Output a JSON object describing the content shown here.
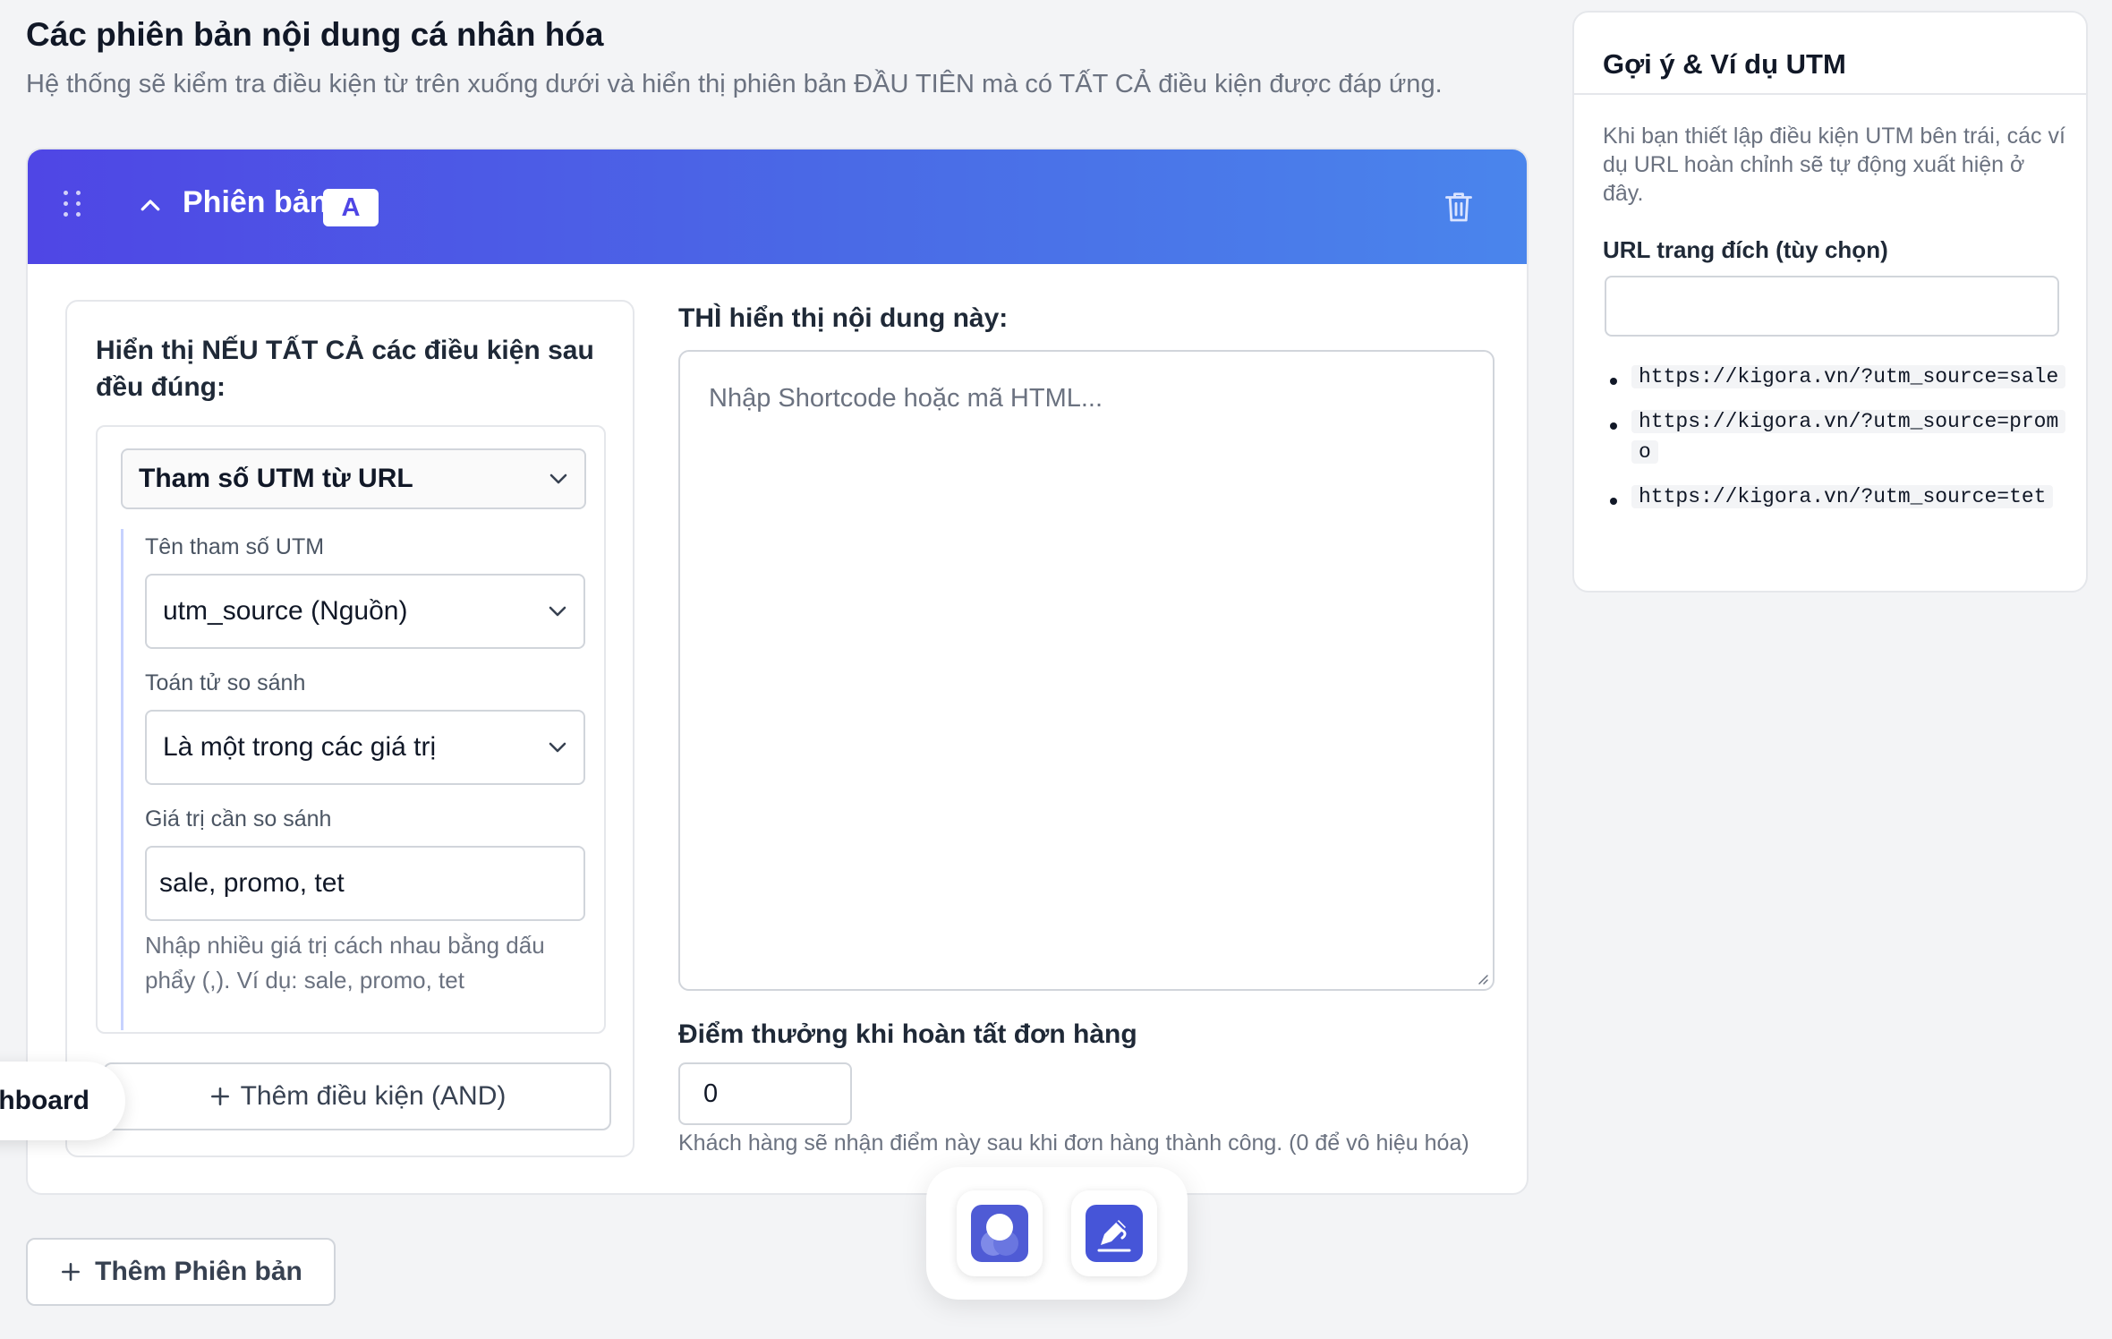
{
  "page": {
    "title": "Các phiên bản nội dung cá nhân hóa",
    "subtitle": "Hệ thống sẽ kiểm tra điều kiện từ trên xuống dưới và hiển thị phiên bản ĐẦU TIÊN mà có TẤT CẢ điều kiện được đáp ứng."
  },
  "version": {
    "label": "Phiên bản",
    "badge": "A",
    "icons": {
      "drag": "drag-handle-icon",
      "collapse": "chevron-up-icon",
      "delete": "trash-icon"
    },
    "conditions": {
      "heading": "Hiển thị NẾU TẤT CẢ các điều kiện sau đều đúng:",
      "type_select": "Tham số UTM từ URL",
      "param_label": "Tên tham số UTM",
      "param_value": "utm_source (Nguồn)",
      "operator_label": "Toán tử so sánh",
      "operator_value": "Là một trong các giá trị",
      "compare_label": "Giá trị cần so sánh",
      "compare_value": "sale, promo, tet",
      "compare_help": "Nhập nhiều giá trị cách nhau bằng dấu phẩy (,). Ví dụ: sale, promo, tet",
      "add_button": "Thêm điều kiện (AND)"
    },
    "content": {
      "label": "THÌ hiển thị nội dung này:",
      "placeholder": "Nhập Shortcode hoặc mã HTML..."
    },
    "points": {
      "label": "Điểm thưởng khi hoàn tất đơn hàng",
      "value": "0",
      "help": "Khách hàng sẽ nhận điểm này sau khi đơn hàng thành công. (0 để vô hiệu hóa)"
    }
  },
  "add_version": {
    "label": "Thêm Phiên bản"
  },
  "hints": {
    "title": "Gợi ý & Ví dụ UTM",
    "description": "Khi bạn thiết lập điều kiện UTM bên trái, các ví dụ URL hoàn chỉnh sẽ tự động xuất hiện ở đây.",
    "url_label": "URL trang đích (tùy chọn)",
    "examples": [
      "https://kigora.vn/?utm_source=sale",
      "https://kigora.vn/?utm_source=promo",
      "https://kigora.vn/?utm_source=tet"
    ]
  },
  "dashboard_pill": {
    "label": "Dashboard"
  },
  "colors": {
    "accent": "#4f46e5",
    "accent_end": "#4a85ec",
    "background": "#f3f4f6"
  }
}
